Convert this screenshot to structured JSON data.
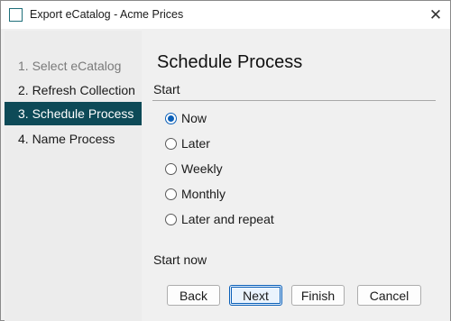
{
  "window": {
    "title": "Export eCatalog - Acme Prices",
    "close_glyph": "✕"
  },
  "sidebar": {
    "steps": [
      {
        "label": "1. Select eCatalog",
        "state": "disabled"
      },
      {
        "label": "2. Refresh Collection",
        "state": "normal"
      },
      {
        "label": "3. Schedule Process",
        "state": "active"
      },
      {
        "label": "4. Name Process",
        "state": "normal"
      }
    ]
  },
  "main": {
    "heading": "Schedule Process",
    "section_label": "Start",
    "options": [
      {
        "label": "Now",
        "checked": true
      },
      {
        "label": "Later",
        "checked": false
      },
      {
        "label": "Weekly",
        "checked": false
      },
      {
        "label": "Monthly",
        "checked": false
      },
      {
        "label": "Later and repeat",
        "checked": false
      }
    ],
    "status_text": "Start now"
  },
  "buttons": {
    "back": "Back",
    "next": "Next",
    "finish": "Finish",
    "cancel": "Cancel"
  },
  "colors": {
    "active_step": "#0d4a57",
    "radio_accent": "#0a5fb8"
  }
}
